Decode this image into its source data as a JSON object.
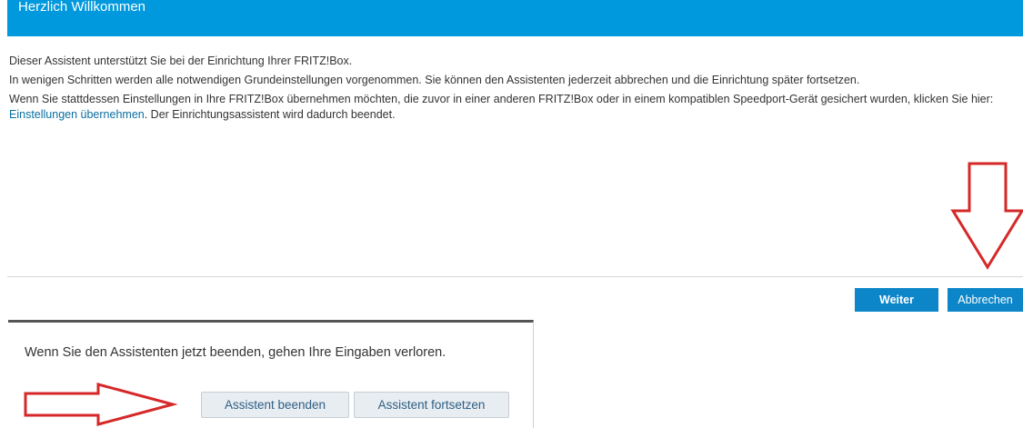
{
  "header": {
    "title": "Herzlich Willkommen"
  },
  "intro": {
    "line1": "Dieser Assistent unterstützt Sie bei der Einrichtung Ihrer FRITZ!Box.",
    "line2": "In wenigen Schritten werden alle notwendigen Grundeinstellungen vorgenommen. Sie können den Assistenten jederzeit abbrechen und die Einrichtung später fortsetzen.",
    "line3_before": "Wenn Sie stattdessen Einstellungen in Ihre FRITZ!Box übernehmen möchten, die zuvor in einer anderen FRITZ!Box oder in einem kompatiblen Speedport-Gerät gesichert wurden, klicken Sie hier: ",
    "line3_link": "Einstellungen übernehmen",
    "line3_after": ". Der Einrichtungsassistent wird dadurch beendet."
  },
  "buttons": {
    "next": "Weiter",
    "cancel": "Abbrechen"
  },
  "dialog": {
    "message": "Wenn Sie den Assistenten jetzt beenden, gehen Ihre Eingaben verloren.",
    "end_label": "Assistent beenden",
    "continue_label": "Assistent fortsetzen"
  },
  "colors": {
    "accent": "#0099dd",
    "button": "#0c86c8",
    "annotation": "#d62828"
  }
}
